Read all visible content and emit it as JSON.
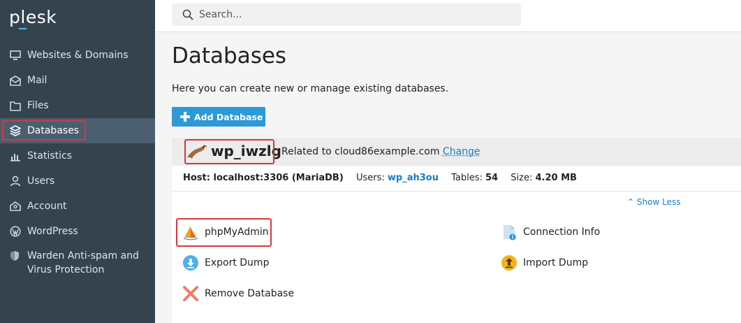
{
  "sidebar": {
    "logo": "plesk",
    "items": [
      {
        "label": "Websites & Domains",
        "icon": "monitor-icon"
      },
      {
        "label": "Mail",
        "icon": "mail-icon"
      },
      {
        "label": "Files",
        "icon": "folder-icon"
      },
      {
        "label": "Databases",
        "icon": "layers-icon",
        "active": true
      },
      {
        "label": "Statistics",
        "icon": "bar-chart-icon"
      },
      {
        "label": "Users",
        "icon": "user-icon"
      },
      {
        "label": "Account",
        "icon": "account-icon"
      },
      {
        "label": "WordPress",
        "icon": "wordpress-icon"
      }
    ],
    "warden": {
      "label_line1": "Warden Anti-spam and",
      "label_line2": "Virus Protection",
      "icon": "shield-icon"
    }
  },
  "search": {
    "placeholder": "Search..."
  },
  "main": {
    "title": "Databases",
    "description": "Here you can create new or manage existing databases.",
    "add_button": "Add Database",
    "database": {
      "name": "wp_iwzlg",
      "related_prefix": "Related to cloud86example.com",
      "change_link": "Change",
      "host_label": "Host: localhost:3306 (MariaDB)",
      "users_label": "Users:",
      "users_value": "wp_ah3ou",
      "tables_label": "Tables:",
      "tables_value": "54",
      "size_label": "Size:",
      "size_value": "4.20 MB",
      "show_less": "Show Less",
      "actions": {
        "phpmyadmin": "phpMyAdmin",
        "connection_info": "Connection Info",
        "export_dump": "Export Dump",
        "import_dump": "Import Dump",
        "remove_database": "Remove Database"
      }
    }
  },
  "colors": {
    "sidebar_bg": "#35434f",
    "active_item_bg": "#4a5e70",
    "accent_blue": "#2b9ad6",
    "highlight_red": "#d8373a",
    "link_blue": "#1a7dc0"
  }
}
